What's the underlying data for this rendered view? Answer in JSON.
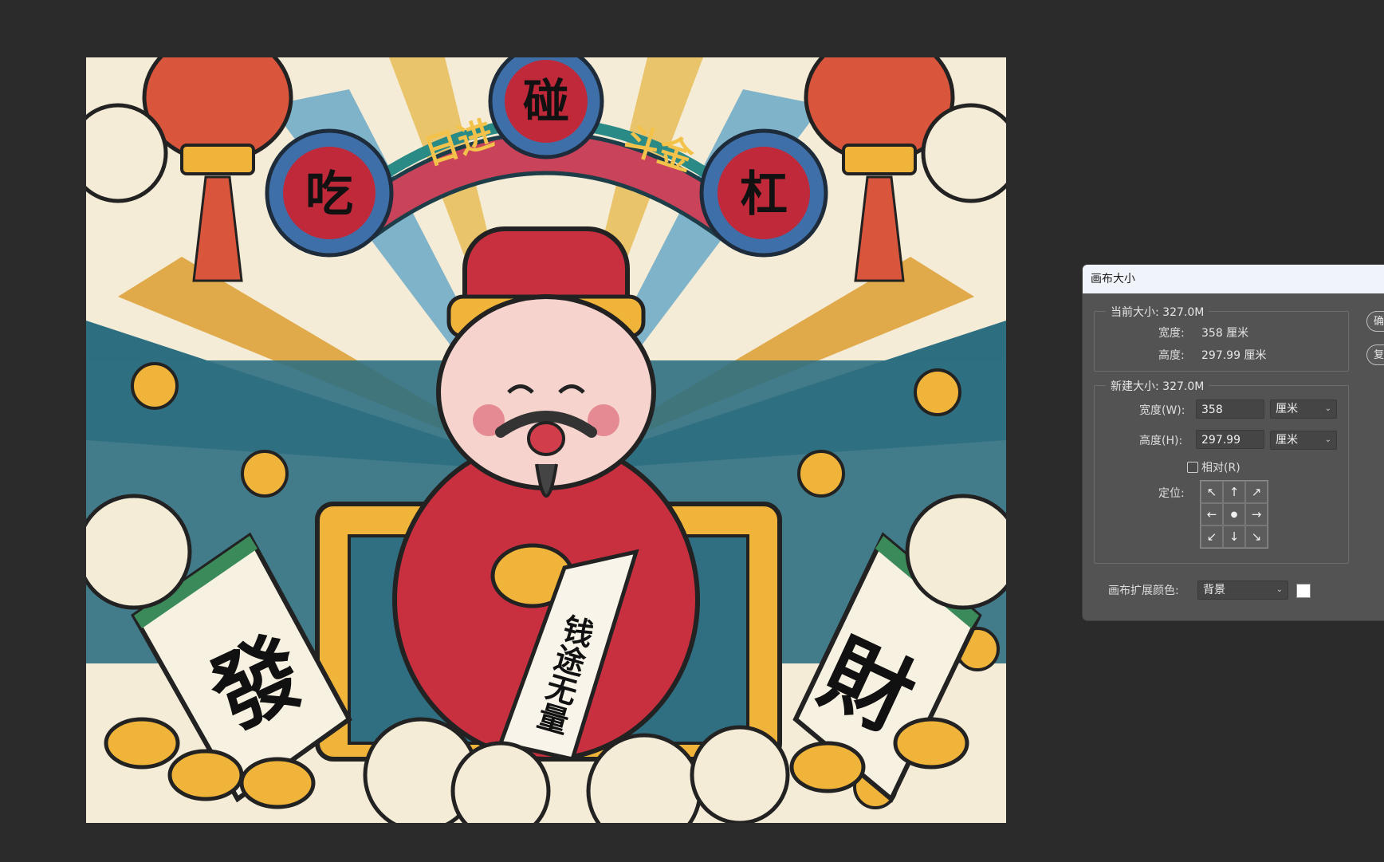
{
  "artwork": {
    "banner_chars": [
      "日进",
      "斗金"
    ],
    "medallions": [
      "碰",
      "吃",
      "杠"
    ],
    "tile_left": "發",
    "tile_right": "財",
    "scroll_text": "钱途无量"
  },
  "dialog": {
    "title": "画布大小",
    "current_size": {
      "legend": "当前大小: 327.0M",
      "width_label": "宽度:",
      "width_value": "358 厘米",
      "height_label": "高度:",
      "height_value": "297.99 厘米"
    },
    "new_size": {
      "legend": "新建大小: 327.0M",
      "width_label": "宽度(W):",
      "width_value": "358",
      "width_unit": "厘米",
      "height_label": "高度(H):",
      "height_value": "297.99",
      "height_unit": "厘米",
      "relative_label": "相对(R)",
      "relative_checked": false,
      "anchor_label": "定位:",
      "anchor_arrows": [
        "↖",
        "↑",
        "↗",
        "←",
        "●",
        "→",
        "↙",
        "↓",
        "↘"
      ]
    },
    "extension_color": {
      "label": "画布扩展颜色:",
      "value": "背景",
      "swatch_color": "#ffffff"
    },
    "side_buttons": [
      "确",
      "复"
    ]
  },
  "colors": {
    "workspace": "#2b2b2b",
    "dialog_bg": "#535353",
    "titlebar_bg": "#f0f3f9"
  }
}
